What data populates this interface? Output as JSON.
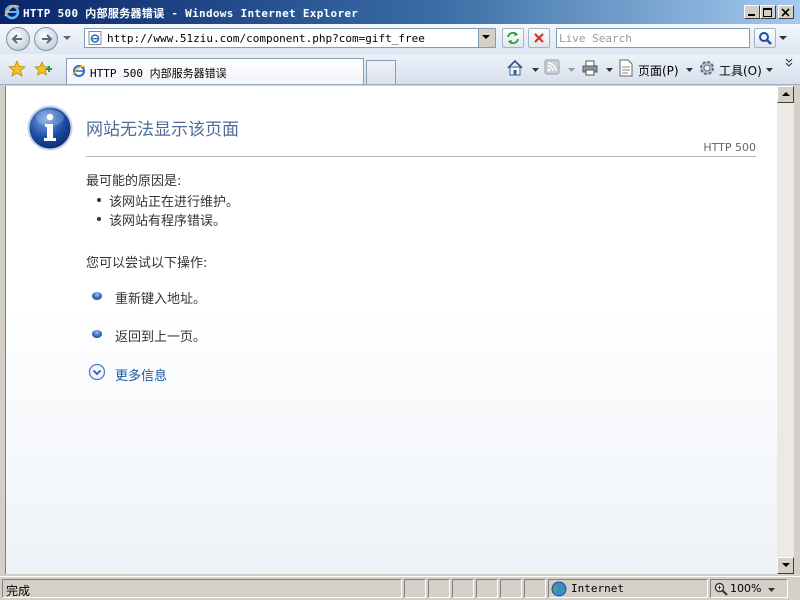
{
  "window": {
    "title": "HTTP 500 内部服务器错误 - Windows Internet Explorer"
  },
  "address_bar": {
    "url": "http://www.51ziu.com/component.php?com=gift_free"
  },
  "search": {
    "placeholder": "Live Search"
  },
  "tabs": [
    {
      "label": "HTTP 500 内部服务器错误",
      "active": true
    }
  ],
  "command_bar": {
    "page_label": "页面(P)",
    "tools_label": "工具(O)"
  },
  "page": {
    "title": "网站无法显示该页面",
    "http_code": "HTTP 500",
    "causes_heading": "最可能的原因是:",
    "causes": [
      "该网站正在进行维护。",
      "该网站有程序错误。"
    ],
    "try_heading": "您可以尝试以下操作:",
    "actions": [
      "重新键入地址。",
      "返回到上一页。"
    ],
    "more_info": "更多信息"
  },
  "status_bar": {
    "status": "完成",
    "zone": "Internet",
    "zoom": "100%"
  },
  "colors": {
    "title_text": "#4e6b9a",
    "link": "#1a5aa0",
    "titlebar_start": "#0a246a"
  },
  "icons": [
    "ie-logo-icon",
    "minimize-icon",
    "maximize-icon",
    "close-icon",
    "back-icon",
    "forward-icon",
    "refresh-icon",
    "stop-icon",
    "search-icon",
    "favorites-star-icon",
    "add-favorites-icon",
    "home-icon",
    "feeds-icon",
    "print-icon",
    "page-icon",
    "tools-gear-icon",
    "info-icon",
    "globe-icon",
    "zoom-icon"
  ]
}
